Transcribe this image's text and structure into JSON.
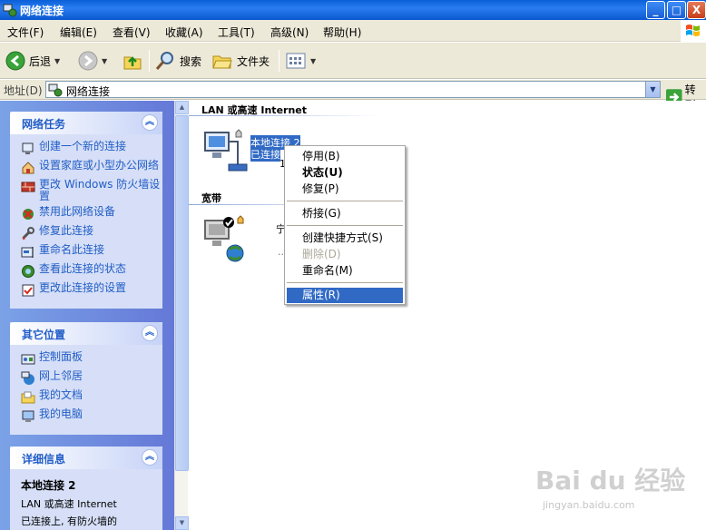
{
  "window": {
    "title": "网络连接",
    "min": "_",
    "max": "□",
    "close": "X"
  },
  "menubar": [
    "文件(F)",
    "编辑(E)",
    "查看(V)",
    "收藏(A)",
    "工具(T)",
    "高级(N)",
    "帮助(H)"
  ],
  "toolbar": {
    "back": "后退",
    "search": "搜索",
    "folders": "文件夹"
  },
  "address": {
    "label": "地址(D)",
    "value": "网络连接",
    "go": "转到"
  },
  "left_pane": {
    "network_tasks": {
      "title": "网络任务",
      "items": [
        "创建一个新的连接",
        "设置家庭或小型办公网络",
        "更改 Windows 防火墙设置",
        "禁用此网络设备",
        "修复此连接",
        "重命名此连接",
        "查看此连接的状态",
        "更改此连接的设置"
      ]
    },
    "other_places": {
      "title": "其它位置",
      "items": [
        "控制面板",
        "网上邻居",
        "我的文档",
        "我的电脑"
      ]
    },
    "details": {
      "title": "详细信息",
      "name": "本地连接 2",
      "type": "LAN 或高速 Internet",
      "status": "已连接上, 有防火墙的"
    }
  },
  "content": {
    "group_lan": "LAN 或高速 Internet",
    "group_broadband": "宽带",
    "connection_name": "本地连接 2",
    "connection_status": "已连接",
    "connection_fragment": "1",
    "broadband_fragment": "宁",
    "broadband_fragment2": "··"
  },
  "context_menu": {
    "items": [
      {
        "label": "停用(B)",
        "style": "normal"
      },
      {
        "label": "状态(U)",
        "style": "bold"
      },
      {
        "label": "修复(P)",
        "style": "normal"
      },
      {
        "label": "桥接(G)",
        "style": "normal"
      },
      {
        "label": "创建快捷方式(S)",
        "style": "normal"
      },
      {
        "label": "删除(D)",
        "style": "disabled"
      },
      {
        "label": "重命名(M)",
        "style": "normal"
      },
      {
        "label": "属性(R)",
        "style": "hover"
      }
    ]
  },
  "watermark": {
    "main": "Bai du 经验",
    "url": "jingyan.baidu.com"
  },
  "colors": {
    "title_blue": "#0a5fd8",
    "task_link": "#215dc6",
    "selection": "#316ac5"
  }
}
